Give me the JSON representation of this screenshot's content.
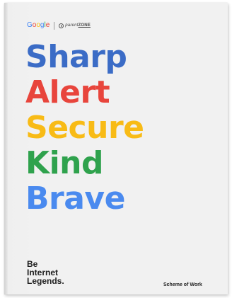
{
  "brand": {
    "google_letters": [
      {
        "char": "G",
        "color": "#4285F4"
      },
      {
        "char": "o",
        "color": "#EA4335"
      },
      {
        "char": "o",
        "color": "#FBBC05"
      },
      {
        "char": "g",
        "color": "#4285F4"
      },
      {
        "char": "l",
        "color": "#34A853"
      },
      {
        "char": "e",
        "color": "#EA4335"
      }
    ],
    "partner_part1": "parent",
    "partner_part2": "ZONE"
  },
  "words": [
    {
      "text": "Sharp",
      "color": "#3B6CC6"
    },
    {
      "text": "Alert",
      "color": "#E8453C"
    },
    {
      "text": "Secure",
      "color": "#F8BB16"
    },
    {
      "text": "Kind",
      "color": "#2FA24D"
    },
    {
      "text": "Brave",
      "color": "#4A8AEF"
    }
  ],
  "footer": {
    "line1": "Be",
    "line2": "Internet",
    "line3": "Legends",
    "dot": ".",
    "document_type": "Scheme of Work"
  }
}
